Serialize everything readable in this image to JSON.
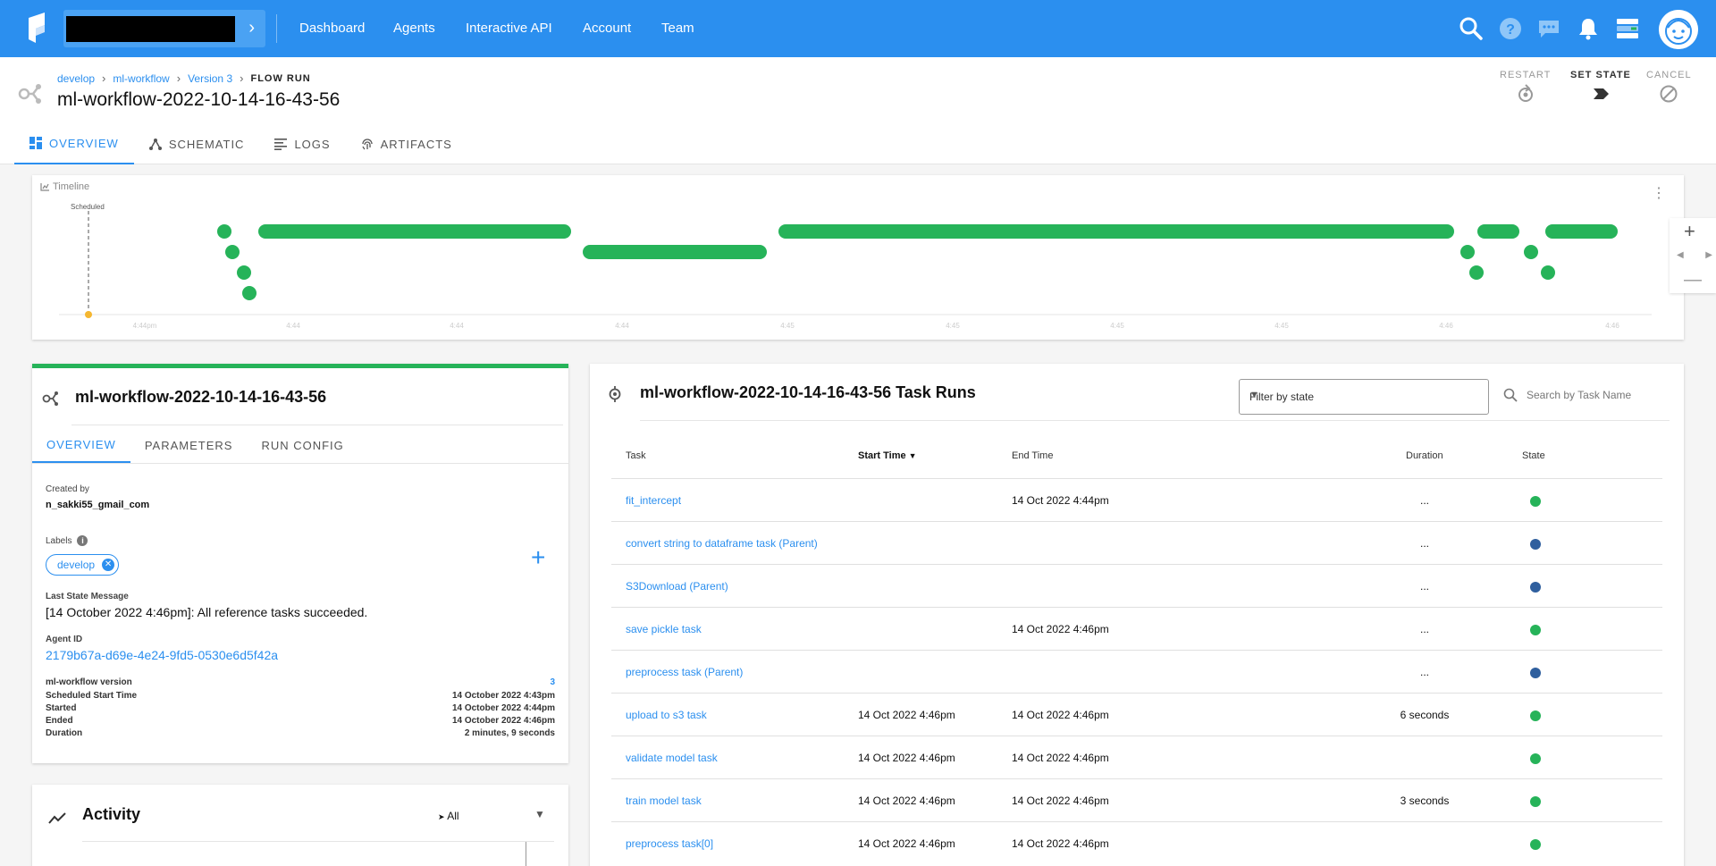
{
  "nav": {
    "items": [
      "Dashboard",
      "Agents",
      "Interactive API",
      "Account",
      "Team"
    ]
  },
  "breadcrumb": {
    "items": [
      "develop",
      "ml-workflow",
      "Version 3"
    ],
    "current": "FLOW RUN"
  },
  "flow_run": {
    "title": "ml-workflow-2022-10-14-16-43-56"
  },
  "actions": {
    "restart": "RESTART",
    "set_state": "SET STATE",
    "cancel": "CANCEL"
  },
  "tabs": [
    "OVERVIEW",
    "SCHEMATIC",
    "LOGS",
    "ARTIFACTS"
  ],
  "timeline": {
    "label": "Timeline",
    "scheduled_label": "Scheduled",
    "ticks": [
      "4:44pm",
      "4:44",
      "4:44",
      "4:44",
      "4:45",
      "4:45",
      "4:45",
      "4:45",
      "4:46",
      "4:46"
    ]
  },
  "details": {
    "title": "ml-workflow-2022-10-14-16-43-56",
    "tabs": [
      "OVERVIEW",
      "PARAMETERS",
      "RUN CONFIG"
    ],
    "created_by_label": "Created by",
    "created_by": "n_sakki55_gmail_com",
    "labels_label": "Labels",
    "label_chip": "develop",
    "last_state_label": "Last State Message",
    "last_state_message": "[14 October 2022 4:46pm]: All reference tasks succeeded.",
    "agent_id_label": "Agent ID",
    "agent_id": "2179b67a-d69e-4e24-9fd5-0530e6d5f42a",
    "meta": [
      {
        "label": "ml-workflow version",
        "value": "3"
      },
      {
        "label": "Scheduled Start Time",
        "value": "14 October 2022 4:43pm"
      },
      {
        "label": "Started",
        "value": "14 October 2022 4:44pm"
      },
      {
        "label": "Ended",
        "value": "14 October 2022 4:46pm"
      },
      {
        "label": "Duration",
        "value": "2 minutes, 9 seconds"
      }
    ]
  },
  "activity": {
    "title": "Activity",
    "filter": "All"
  },
  "task_runs": {
    "title": "ml-workflow-2022-10-14-16-43-56 Task Runs",
    "filter_placeholder": "Filter by state",
    "search_placeholder": "Search by Task Name",
    "columns": [
      "Task",
      "Start Time",
      "End Time",
      "Duration",
      "State"
    ],
    "rows": [
      {
        "task": "fit_intercept",
        "start": "",
        "end": "14 Oct 2022 4:44pm",
        "duration": "...",
        "state_color": "#26b359"
      },
      {
        "task": "convert string to dataframe task (Parent)",
        "start": "",
        "end": "",
        "duration": "...",
        "state_color": "#2f5f9e"
      },
      {
        "task": "S3Download (Parent)",
        "start": "",
        "end": "",
        "duration": "...",
        "state_color": "#2f5f9e"
      },
      {
        "task": "save pickle task",
        "start": "",
        "end": "14 Oct 2022 4:46pm",
        "duration": "...",
        "state_color": "#26b359"
      },
      {
        "task": "preprocess task (Parent)",
        "start": "",
        "end": "",
        "duration": "...",
        "state_color": "#2f5f9e"
      },
      {
        "task": "upload to s3 task",
        "start": "14 Oct 2022 4:46pm",
        "end": "14 Oct 2022 4:46pm",
        "duration": "6 seconds",
        "state_color": "#26b359"
      },
      {
        "task": "validate model task",
        "start": "14 Oct 2022 4:46pm",
        "end": "14 Oct 2022 4:46pm",
        "duration": "",
        "state_color": "#26b359"
      },
      {
        "task": "train model task",
        "start": "14 Oct 2022 4:46pm",
        "end": "14 Oct 2022 4:46pm",
        "duration": "3 seconds",
        "state_color": "#26b359"
      },
      {
        "task": "preprocess task[0]",
        "start": "14 Oct 2022 4:46pm",
        "end": "14 Oct 2022 4:46pm",
        "duration": "",
        "state_color": "#26b359"
      }
    ]
  },
  "colors": {
    "brand": "#2b8fef",
    "success": "#26b359",
    "pending": "#2f5f9e",
    "scheduled": "#f5b731"
  }
}
